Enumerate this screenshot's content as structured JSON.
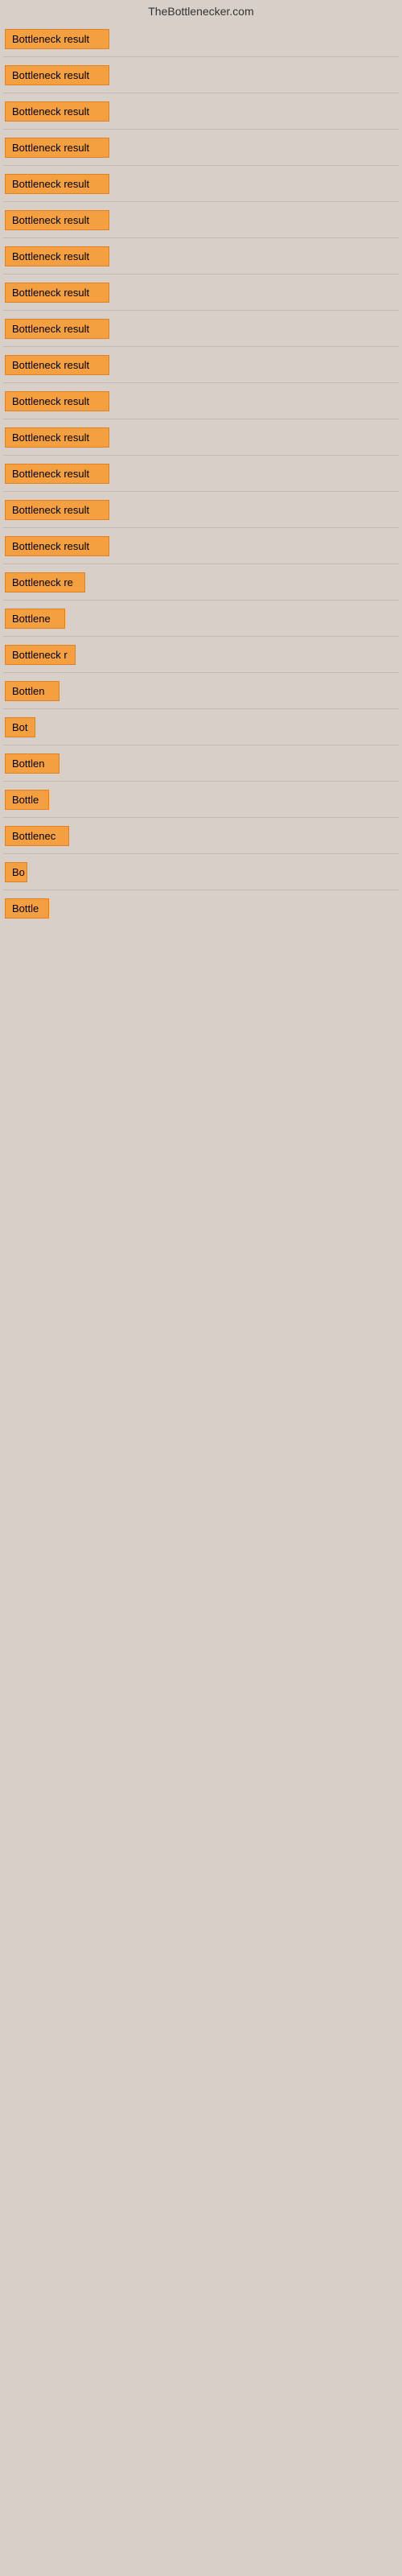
{
  "header": {
    "title": "TheBottlenecker.com"
  },
  "items": [
    {
      "id": 1,
      "label": "Bottleneck result",
      "width": 130
    },
    {
      "id": 2,
      "label": "Bottleneck result",
      "width": 130
    },
    {
      "id": 3,
      "label": "Bottleneck result",
      "width": 130
    },
    {
      "id": 4,
      "label": "Bottleneck result",
      "width": 130
    },
    {
      "id": 5,
      "label": "Bottleneck result",
      "width": 130
    },
    {
      "id": 6,
      "label": "Bottleneck result",
      "width": 130
    },
    {
      "id": 7,
      "label": "Bottleneck result",
      "width": 130
    },
    {
      "id": 8,
      "label": "Bottleneck result",
      "width": 130
    },
    {
      "id": 9,
      "label": "Bottleneck result",
      "width": 130
    },
    {
      "id": 10,
      "label": "Bottleneck result",
      "width": 130
    },
    {
      "id": 11,
      "label": "Bottleneck result",
      "width": 130
    },
    {
      "id": 12,
      "label": "Bottleneck result",
      "width": 130
    },
    {
      "id": 13,
      "label": "Bottleneck result",
      "width": 130
    },
    {
      "id": 14,
      "label": "Bottleneck result",
      "width": 130
    },
    {
      "id": 15,
      "label": "Bottleneck result",
      "width": 130
    },
    {
      "id": 16,
      "label": "Bottleneck re",
      "width": 100
    },
    {
      "id": 17,
      "label": "Bottlene",
      "width": 75
    },
    {
      "id": 18,
      "label": "Bottleneck r",
      "width": 88
    },
    {
      "id": 19,
      "label": "Bottlen",
      "width": 68
    },
    {
      "id": 20,
      "label": "Bot",
      "width": 38
    },
    {
      "id": 21,
      "label": "Bottlen",
      "width": 68
    },
    {
      "id": 22,
      "label": "Bottle",
      "width": 55
    },
    {
      "id": 23,
      "label": "Bottlenec",
      "width": 80
    },
    {
      "id": 24,
      "label": "Bo",
      "width": 28
    },
    {
      "id": 25,
      "label": "Bottle",
      "width": 55
    }
  ]
}
